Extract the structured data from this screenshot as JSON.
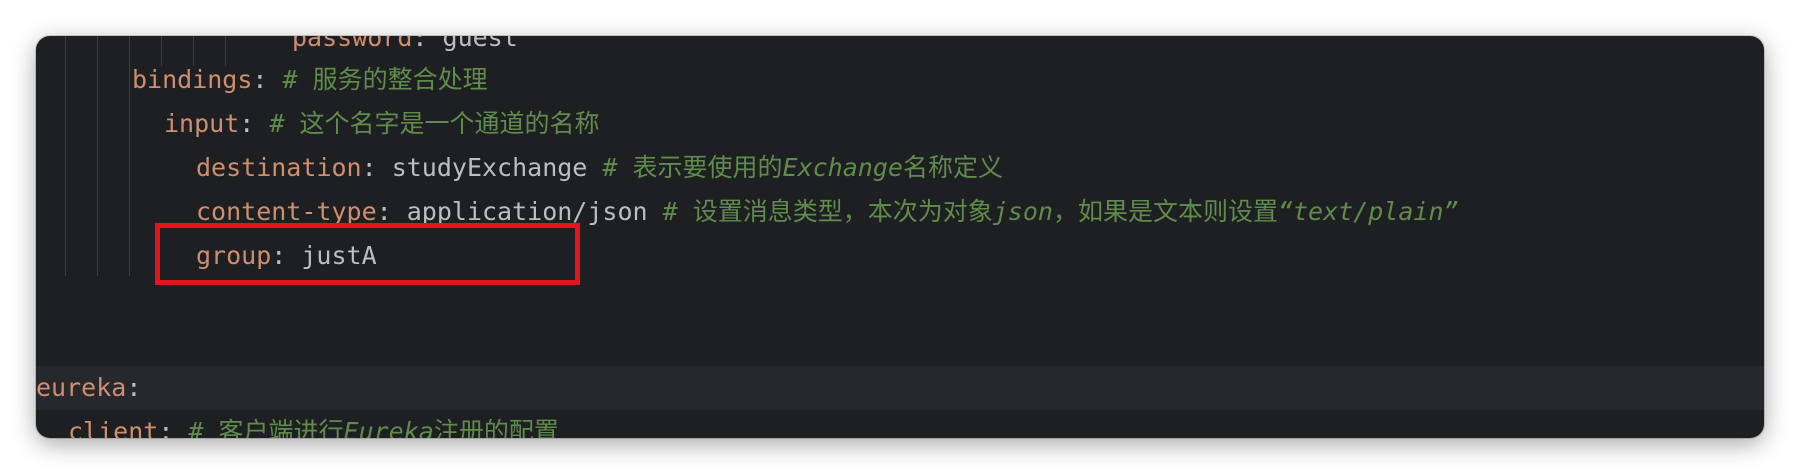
{
  "editor": {
    "lines": [
      {
        "key": "password",
        "sep": ": ",
        "value": "guest",
        "comment": []
      },
      {
        "key": "bindings",
        "sep": ": ",
        "value": "",
        "comment": [
          {
            "text": "# 服务的整合处理",
            "italic": false
          }
        ]
      },
      {
        "key": "input",
        "sep": ": ",
        "value": "",
        "comment": [
          {
            "text": "# 这个名字是一个通道的名称",
            "italic": false
          }
        ]
      },
      {
        "key": "destination",
        "sep": ": ",
        "value": "studyExchange ",
        "comment": [
          {
            "text": "# 表示要使用的",
            "italic": false
          },
          {
            "text": "Exchange",
            "italic": true
          },
          {
            "text": "名称定义",
            "italic": false
          }
        ]
      },
      {
        "key": "content-type",
        "sep": ": ",
        "value": "application/json ",
        "comment": [
          {
            "text": "# 设置消息类型，本次为对象",
            "italic": false
          },
          {
            "text": "json",
            "italic": true
          },
          {
            "text": "，如果是文本则设置",
            "italic": false
          },
          {
            "text": "“text/plain”",
            "italic": true
          }
        ]
      },
      {
        "key": "group",
        "sep": ": ",
        "value": "justA",
        "comment": []
      },
      {
        "key": "eureka",
        "sep": ":",
        "value": "",
        "comment": []
      },
      {
        "key": "client",
        "sep": ": ",
        "value": "",
        "comment": [
          {
            "text": "# 客户端进行",
            "italic": false
          },
          {
            "text": "Eureka",
            "italic": true
          },
          {
            "text": "注册的配置",
            "italic": false
          }
        ]
      }
    ]
  },
  "colors": {
    "background": "#1e1f22",
    "key": "#cf8e6d",
    "value": "#bcbec4",
    "comment": "#5f8c4a",
    "highlight_box": "#e5141c",
    "current_line": "#26282e"
  }
}
